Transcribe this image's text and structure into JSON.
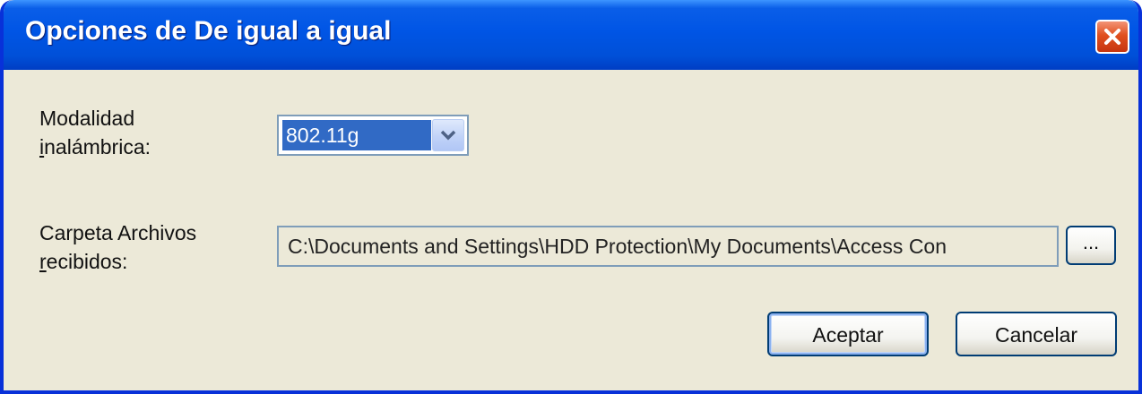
{
  "window": {
    "title": "Opciones de De igual a igual",
    "close_icon": "close-icon",
    "colors": {
      "titlebar": "#0055e5",
      "body": "#ece9d8",
      "selection": "#316ac5",
      "close": "#e0501f"
    }
  },
  "wireless_mode": {
    "label_line1": "Modalidad",
    "label_line2_underlined": "i",
    "label_line2_rest": "nalámbrica:",
    "selected_value": "802.11g",
    "dropdown_icon": "chevron-down-icon"
  },
  "received_folder": {
    "label_line1": "Carpeta Archivos",
    "label_line2_underlined": "r",
    "label_line2_rest": "ecibidos:",
    "path_value": "C:\\Documents and Settings\\HDD Protection\\My Documents\\Access Con",
    "browse_label": "..."
  },
  "buttons": {
    "ok_label": "Aceptar",
    "cancel_label": "Cancelar"
  }
}
